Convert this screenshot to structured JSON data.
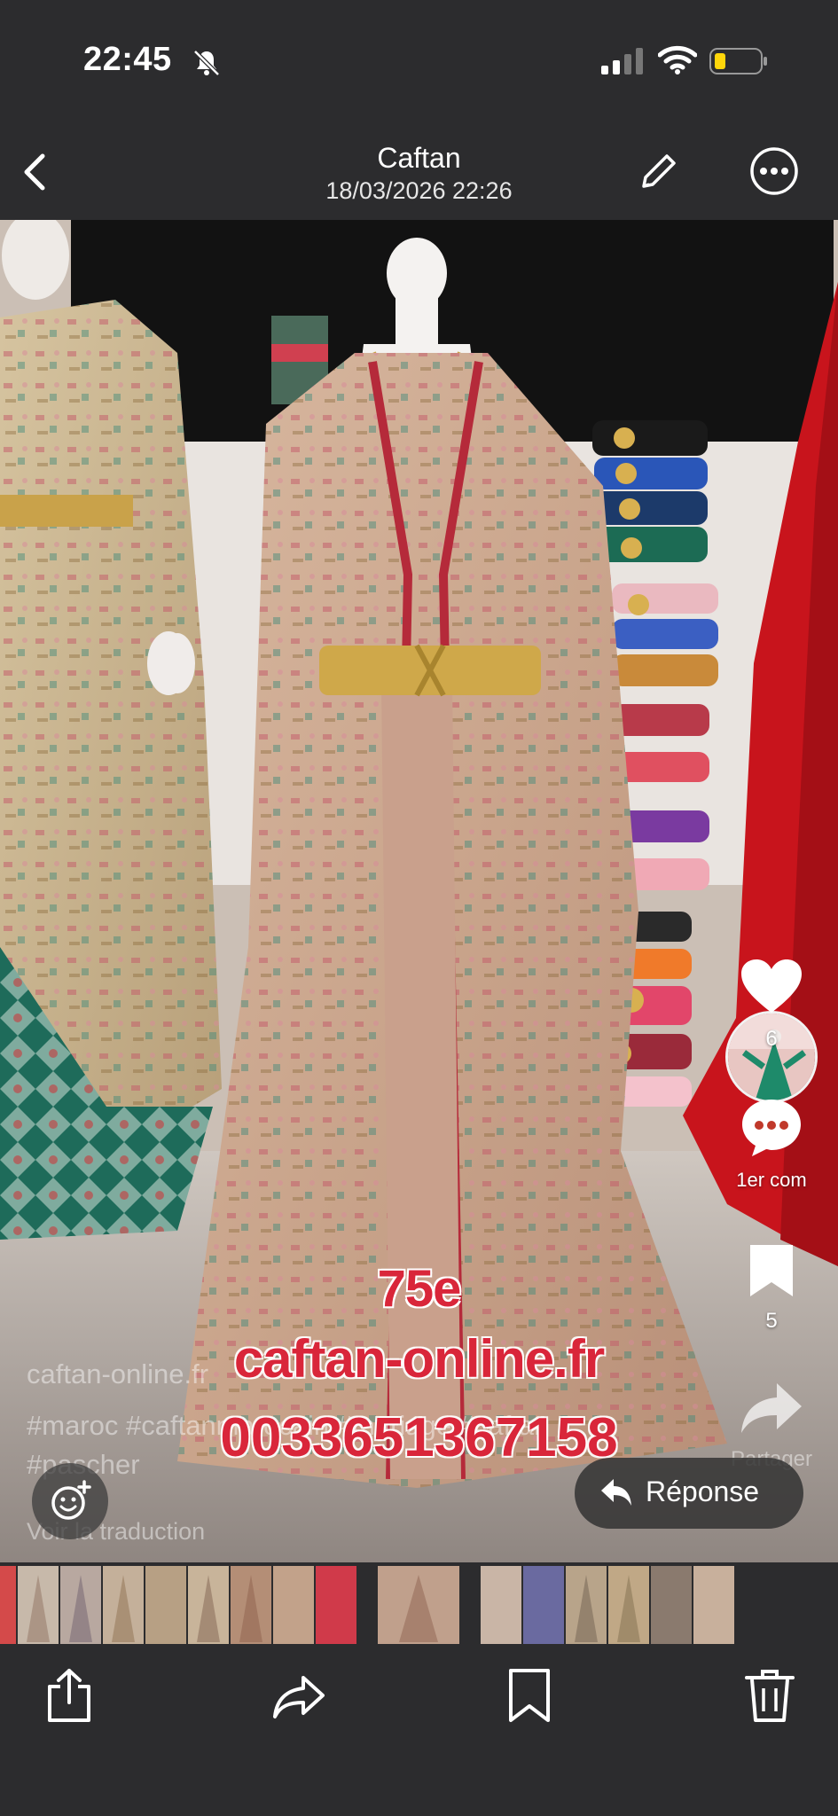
{
  "status_bar": {
    "time": "22:45"
  },
  "header": {
    "title": "Caftan",
    "subtitle": "18/03/2026 22:26"
  },
  "overlay": {
    "price": "75e",
    "website": "caftan-online.fr",
    "phone": "0033651367158"
  },
  "caption": {
    "line1": "caftan-online.fr",
    "line2": "#maroc #caftanmarocain #mariage #caftan #pascher",
    "see_translation": "Voir la traduction"
  },
  "actions": {
    "like_count": "6",
    "comment_label": "1er com",
    "save_count": "5",
    "share_label": "Partager"
  },
  "reply_button": {
    "label": "Réponse"
  },
  "icons": [
    "back-icon",
    "pencil-icon",
    "more-icon",
    "bell-off-icon",
    "signal-icon",
    "wifi-icon",
    "battery-icon",
    "heart-icon",
    "comment-icon",
    "bookmark-icon",
    "share-icon",
    "emoji-icon",
    "reply-icon",
    "upload-icon",
    "forward-icon",
    "trash-icon"
  ],
  "colors": {
    "background": "#2c2c2e",
    "overlay_text": "#d9263a",
    "battery_level": "#ffd60a"
  }
}
